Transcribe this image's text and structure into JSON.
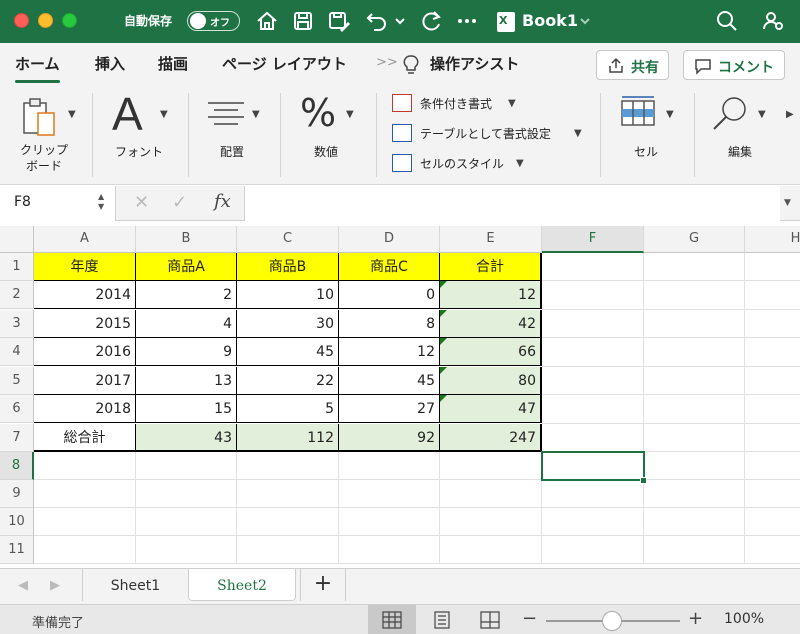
{
  "titlebar": {
    "autosave_label": "自動保存",
    "autosave_state": "オフ",
    "doc_title": "Book1"
  },
  "ribbon_tabs": [
    "ホーム",
    "挿入",
    "描画",
    "ページ レイアウト"
  ],
  "ribbon_tab_active": "ホーム",
  "ribbon_assist": "操作アシスト",
  "share_label": "共有",
  "comment_label": "コメント",
  "ribbon": {
    "clipboard": "クリップ\nボード",
    "clipboard_line1": "クリップ",
    "clipboard_line2": "ボード",
    "font": "フォント",
    "align": "配置",
    "number": "数値",
    "cond_format": "条件付き書式",
    "table_format": "テーブルとして書式設定",
    "cell_style": "セルのスタイル",
    "cells": "セル",
    "edit": "編集"
  },
  "formula_bar": {
    "name_box": "F8",
    "fx": "fx",
    "value": ""
  },
  "columns": [
    "A",
    "B",
    "C",
    "D",
    "E",
    "F",
    "G",
    "H"
  ],
  "selected_column": "F",
  "rows": [
    "1",
    "2",
    "3",
    "4",
    "5",
    "6",
    "7",
    "8",
    "9",
    "10",
    "11"
  ],
  "selected_row": "8",
  "table": {
    "header": [
      "年度",
      "商品A",
      "商品B",
      "商品C",
      "合計"
    ],
    "body": [
      [
        "2014",
        "2",
        "10",
        "0",
        "12"
      ],
      [
        "2015",
        "4",
        "30",
        "8",
        "42"
      ],
      [
        "2016",
        "9",
        "45",
        "12",
        "66"
      ],
      [
        "2017",
        "13",
        "22",
        "45",
        "80"
      ],
      [
        "2018",
        "15",
        "5",
        "27",
        "47"
      ]
    ],
    "total": [
      "総合計",
      "43",
      "112",
      "92",
      "247"
    ]
  },
  "sheets": [
    "Sheet1",
    "Sheet2"
  ],
  "active_sheet": "Sheet2",
  "add_sheet": "+",
  "status": {
    "text": "準備完了",
    "zoom_minus": "−",
    "zoom_plus": "+",
    "zoom": "100%",
    "zoom_fraction": 0.5
  },
  "colors": {
    "brand_green": "#1f7244",
    "header_fill": "#ffff00",
    "sum_fill": "#e2efda"
  },
  "icons": [
    "home-icon",
    "save-icon",
    "save-as-icon",
    "undo-icon",
    "redo-icon",
    "more-icon",
    "excel-doc-icon",
    "search-icon",
    "share-person-icon",
    "lightbulb-icon",
    "share-icon",
    "comment-icon",
    "paste-icon",
    "font-icon",
    "align-icon",
    "percent-icon",
    "conditional-format-icon",
    "table-format-icon",
    "cell-style-icon",
    "cells-icon",
    "search-edit-icon",
    "scroll-arrow-icon",
    "cancel-icon",
    "check-icon",
    "normal-view-icon",
    "page-layout-icon",
    "page-break-icon"
  ]
}
